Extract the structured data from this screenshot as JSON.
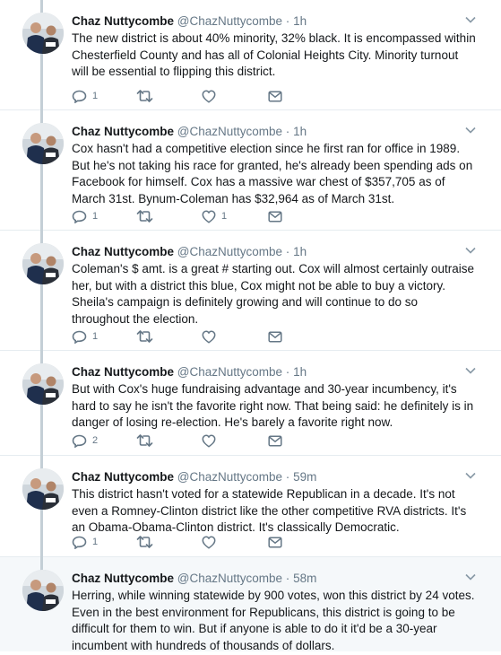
{
  "colors": {
    "text": "#14171a",
    "secondary": "#657786",
    "thread_line": "#c4cfd6",
    "divider": "#e6ecf0",
    "highlight_bg": "#f5f8fa"
  },
  "tweets": [
    {
      "name": "Chaz Nuttycombe",
      "handle": "@ChazNuttycombe",
      "dot": "·",
      "time": "1h",
      "text": "The new district is about 40% minority, 32% black. It is encompassed within Chesterfield County and has all of Colonial Heights City. Minority turnout will be essential to flipping this district.",
      "replies": "1",
      "retweets": "",
      "likes": ""
    },
    {
      "name": "Chaz Nuttycombe",
      "handle": "@ChazNuttycombe",
      "dot": "·",
      "time": "1h",
      "text": "Cox hasn't had a competitive election since he first ran for office in 1989. But he's not taking his race for granted, he's already been spending ads on Facebook for himself. Cox has a massive war chest of $357,705 as of March 31st. Bynum-Coleman has $32,964 as of March 31st.",
      "replies": "1",
      "retweets": "",
      "likes": "1"
    },
    {
      "name": "Chaz Nuttycombe",
      "handle": "@ChazNuttycombe",
      "dot": "·",
      "time": "1h",
      "text": "Coleman's $ amt. is a great # starting out. Cox will almost certainly outraise her, but with a district this blue, Cox might not be able to buy a victory. Sheila's campaign is definitely growing and will continue to do so throughout the election.",
      "replies": "1",
      "retweets": "",
      "likes": ""
    },
    {
      "name": "Chaz Nuttycombe",
      "handle": "@ChazNuttycombe",
      "dot": "·",
      "time": "1h",
      "text": "But with Cox's huge fundraising advantage and 30-year incumbency, it's hard to say he isn't the favorite right now. That being said: he definitely is in danger of losing re-election. He's barely a favorite right now.",
      "replies": "2",
      "retweets": "",
      "likes": ""
    },
    {
      "name": "Chaz Nuttycombe",
      "handle": "@ChazNuttycombe",
      "dot": "·",
      "time": "59m",
      "text": "This district hasn't voted for a statewide Republican in a decade. It's not even a Romney-Clinton district like the other competitive RVA districts. It's an Obama-Obama-Clinton district. It's classically Democratic.",
      "replies": "1",
      "retweets": "",
      "likes": ""
    },
    {
      "name": "Chaz Nuttycombe",
      "handle": "@ChazNuttycombe",
      "dot": "·",
      "time": "58m",
      "text": "Herring, while winning statewide by 900 votes, won this district by 24 votes. Even in the best environment for Republicans, this district is going to be difficult for them to win. But if anyone is able to do it it'd be a 30-year incumbent with hundreds of thousands of dollars.",
      "replies": "",
      "retweets": "",
      "likes": ""
    }
  ]
}
